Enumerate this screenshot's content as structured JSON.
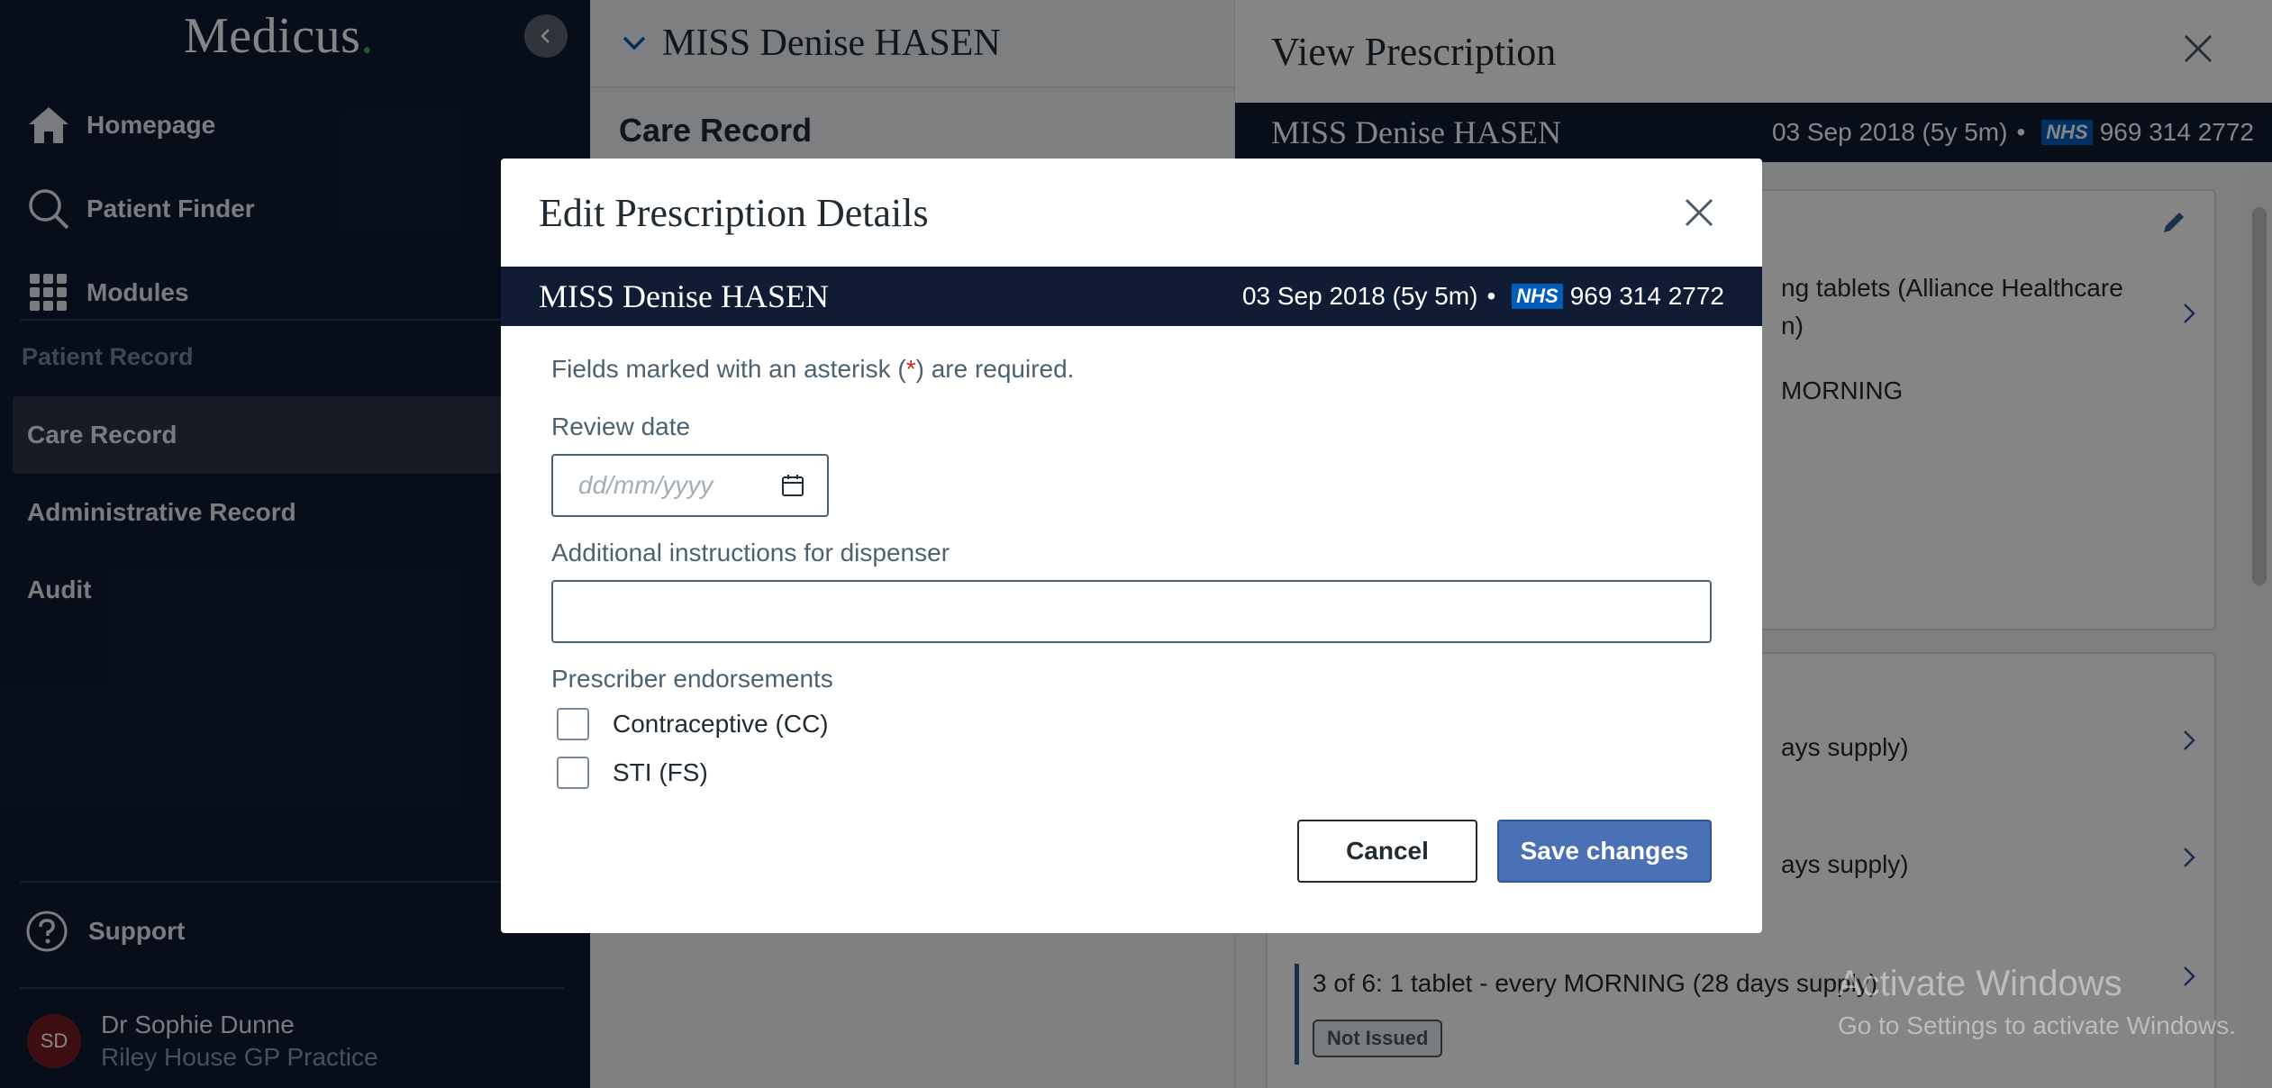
{
  "app": {
    "logo_text": "Medicus",
    "logo_dot": "."
  },
  "sidebar": {
    "nav": [
      {
        "label": "Homepage",
        "icon": "home-icon"
      },
      {
        "label": "Patient Finder",
        "icon": "search-icon"
      },
      {
        "label": "Modules",
        "icon": "grid-icon"
      }
    ],
    "section_title": "Patient Record",
    "record_items": [
      {
        "label": "Care Record",
        "active": true
      },
      {
        "label": "Administrative Record",
        "active": false
      },
      {
        "label": "Audit",
        "active": false
      }
    ],
    "support_label": "Support",
    "user": {
      "initials": "SD",
      "name": "Dr Sophie Dunne",
      "practice": "Riley House GP Practice"
    }
  },
  "middle": {
    "patient_name": "MISS Denise HASEN",
    "page_title": "Care Record"
  },
  "right_panel": {
    "title": "View Prescription",
    "banner": {
      "name": "MISS Denise HASEN",
      "dob": "03 Sep 2018 (5y 5m)",
      "nhs_logo": "NHS",
      "nhs_number": "969 314 2772"
    },
    "drug_line1": "ng tablets (Alliance Healthcare",
    "drug_line2": "n)",
    "dose_text": "MORNING",
    "issues": [
      {
        "text": "ays supply)"
      },
      {
        "text": "ays supply)"
      },
      {
        "text": "3 of 6: 1 tablet - every MORNING (28 days supply)",
        "badge": "Not Issued"
      }
    ]
  },
  "watermark": {
    "line1": "Activate Windows",
    "line2": "Go to Settings to activate Windows."
  },
  "modal": {
    "title": "Edit Prescription Details",
    "banner": {
      "name": "MISS Denise HASEN",
      "dob": "03 Sep 2018 (5y 5m)",
      "nhs_logo": "NHS",
      "nhs_number": "969 314 2772"
    },
    "hint_before": "Fields marked with an asterisk (",
    "hint_ast": "*",
    "hint_after": ") are required.",
    "review_date_label": "Review date",
    "review_date_placeholder": "dd/mm/yyyy",
    "instructions_label": "Additional instructions for dispenser",
    "instructions_value": "",
    "endorsements_label": "Prescriber endorsements",
    "endorsements": [
      {
        "label": "Contraceptive (CC)",
        "checked": false
      },
      {
        "label": "STI (FS)",
        "checked": false
      }
    ],
    "cancel_label": "Cancel",
    "save_label": "Save changes"
  },
  "colors": {
    "navy": "#0f1c33",
    "primary_button": "#4a71b5",
    "nhs_blue": "#005eb8",
    "required": "#d5281b",
    "logo_accent": "#33b36b"
  }
}
